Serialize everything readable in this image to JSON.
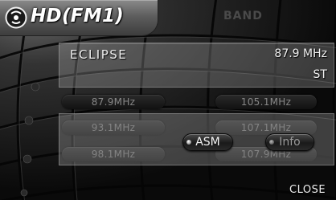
{
  "header": {
    "title": "HD(FM1)",
    "band_label": "BAND",
    "logo_icon": "satellite-radio-icon"
  },
  "station": {
    "name": "ECLIPSE",
    "frequency": "87.9 MHz",
    "stereo": "ST"
  },
  "presets": [
    {
      "label": "87.9MHz"
    },
    {
      "label": "105.1MHz"
    },
    {
      "label": "93.1MHz"
    },
    {
      "label": "107.1MHz"
    },
    {
      "label": "98.1MHz"
    },
    {
      "label": "107.9MHz"
    }
  ],
  "popup": {
    "asm_label": "ASM",
    "info_label": "Info"
  },
  "footer": {
    "close_label": "CLOSE"
  },
  "colors": {
    "accent": "#ffffff",
    "panel": "#bebebe",
    "background": "#111111"
  }
}
